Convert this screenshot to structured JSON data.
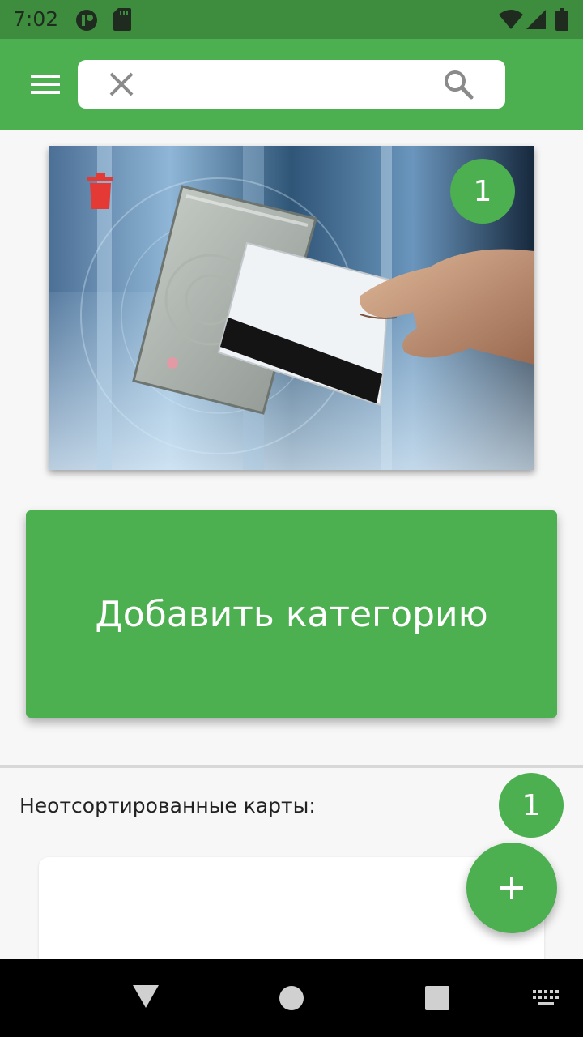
{
  "status_bar": {
    "time": "7:02",
    "icons": [
      "clock-app-icon",
      "sd-card-icon",
      "wifi-icon",
      "signal-icon",
      "battery-icon"
    ]
  },
  "app_bar": {
    "menu_icon": "hamburger-menu-icon",
    "search": {
      "value": "",
      "placeholder": ""
    },
    "clear_icon": "close-icon",
    "search_icon": "search-icon"
  },
  "category": {
    "image": "hand-swiping-card-on-reader",
    "delete_icon": "trash-icon",
    "count": "1"
  },
  "add_category_label": "Добавить категорию",
  "unsorted": {
    "label": "Неотсортированные карты:",
    "count": "1"
  },
  "fab_icon": "plus-icon",
  "nav_bar": {
    "back_icon": "back-triangle-icon",
    "home_icon": "home-circle-icon",
    "recents_icon": "recents-square-icon",
    "keyboard_icon": "keyboard-icon"
  },
  "colors": {
    "accent": "#4caf50",
    "status_bar": "#3e8d3f",
    "trash": "#e53935"
  }
}
